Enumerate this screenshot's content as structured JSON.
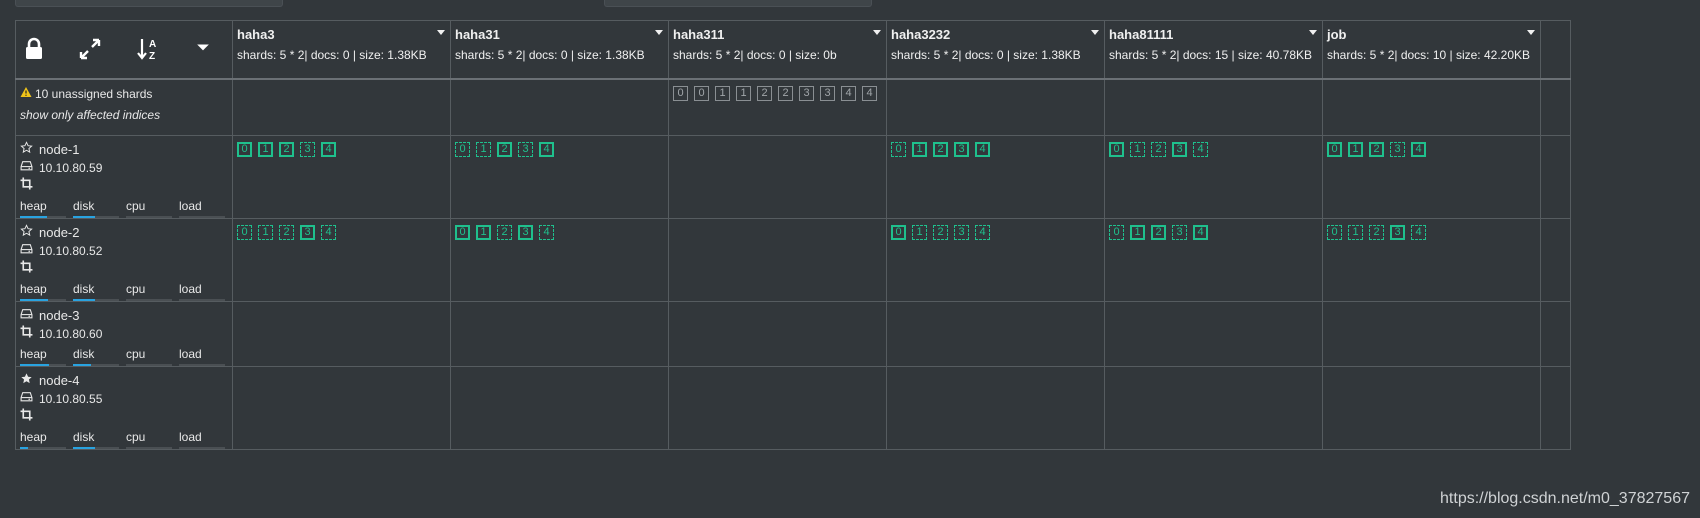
{
  "controls": [
    {
      "name": "lock-icon"
    },
    {
      "name": "expand-icon"
    },
    {
      "name": "sort-alpha-icon"
    },
    {
      "name": "caret-down-icon"
    }
  ],
  "indices": [
    {
      "name": "haha3",
      "stats": "shards: 5 * 2| docs: 0 | size: 1.38KB"
    },
    {
      "name": "haha31",
      "stats": "shards: 5 * 2| docs: 0 | size: 1.38KB"
    },
    {
      "name": "haha311",
      "stats": "shards: 5 * 2| docs: 0 | size: 0b"
    },
    {
      "name": "haha3232",
      "stats": "shards: 5 * 2| docs: 0 | size: 1.38KB"
    },
    {
      "name": "haha81111",
      "stats": "shards: 5 * 2| docs: 15 | size: 40.78KB"
    },
    {
      "name": "job",
      "stats": "shards: 5 * 2| docs: 10 | size: 42.20KB"
    }
  ],
  "unassigned": {
    "message": "10 unassigned shards",
    "filter_link": "show only affected indices",
    "shards_by_index": [
      [],
      [],
      [
        "0",
        "0",
        "1",
        "1",
        "2",
        "2",
        "3",
        "3",
        "4",
        "4"
      ],
      [],
      [],
      []
    ]
  },
  "metric_labels": [
    "heap",
    "disk",
    "cpu",
    "load"
  ],
  "nodes": [
    {
      "name": "node-1",
      "ip": "10.10.80.59",
      "master": "eligible",
      "roles": [
        "data",
        "ingest"
      ],
      "metrics": {
        "heap": 0.58,
        "disk": 0.48,
        "cpu": 0,
        "load": 0
      },
      "shards": [
        [
          {
            "n": "0",
            "t": "p"
          },
          {
            "n": "1",
            "t": "p"
          },
          {
            "n": "2",
            "t": "p"
          },
          {
            "n": "3",
            "t": "r"
          },
          {
            "n": "4",
            "t": "p"
          }
        ],
        [
          {
            "n": "0",
            "t": "r"
          },
          {
            "n": "1",
            "t": "r"
          },
          {
            "n": "2",
            "t": "p"
          },
          {
            "n": "3",
            "t": "r"
          },
          {
            "n": "4",
            "t": "p"
          }
        ],
        [],
        [
          {
            "n": "0",
            "t": "r"
          },
          {
            "n": "1",
            "t": "p"
          },
          {
            "n": "2",
            "t": "p"
          },
          {
            "n": "3",
            "t": "p"
          },
          {
            "n": "4",
            "t": "p"
          }
        ],
        [
          {
            "n": "0",
            "t": "p"
          },
          {
            "n": "1",
            "t": "r"
          },
          {
            "n": "2",
            "t": "r"
          },
          {
            "n": "3",
            "t": "p"
          },
          {
            "n": "4",
            "t": "r"
          }
        ],
        [
          {
            "n": "0",
            "t": "p"
          },
          {
            "n": "1",
            "t": "p"
          },
          {
            "n": "2",
            "t": "p"
          },
          {
            "n": "3",
            "t": "r"
          },
          {
            "n": "4",
            "t": "p"
          }
        ]
      ]
    },
    {
      "name": "node-2",
      "ip": "10.10.80.52",
      "master": "eligible",
      "roles": [
        "data",
        "ingest"
      ],
      "metrics": {
        "heap": 0.6,
        "disk": 0.48,
        "cpu": 0,
        "load": 0
      },
      "shards": [
        [
          {
            "n": "0",
            "t": "r"
          },
          {
            "n": "1",
            "t": "r"
          },
          {
            "n": "2",
            "t": "r"
          },
          {
            "n": "3",
            "t": "p"
          },
          {
            "n": "4",
            "t": "r"
          }
        ],
        [
          {
            "n": "0",
            "t": "p"
          },
          {
            "n": "1",
            "t": "p"
          },
          {
            "n": "2",
            "t": "r"
          },
          {
            "n": "3",
            "t": "p"
          },
          {
            "n": "4",
            "t": "r"
          }
        ],
        [],
        [
          {
            "n": "0",
            "t": "p"
          },
          {
            "n": "1",
            "t": "r"
          },
          {
            "n": "2",
            "t": "r"
          },
          {
            "n": "3",
            "t": "r"
          },
          {
            "n": "4",
            "t": "r"
          }
        ],
        [
          {
            "n": "0",
            "t": "r"
          },
          {
            "n": "1",
            "t": "p"
          },
          {
            "n": "2",
            "t": "p"
          },
          {
            "n": "3",
            "t": "r"
          },
          {
            "n": "4",
            "t": "p"
          }
        ],
        [
          {
            "n": "0",
            "t": "r"
          },
          {
            "n": "1",
            "t": "r"
          },
          {
            "n": "2",
            "t": "r"
          },
          {
            "n": "3",
            "t": "p"
          },
          {
            "n": "4",
            "t": "r"
          }
        ]
      ]
    },
    {
      "name": "node-3",
      "ip": "10.10.80.60",
      "master": "none",
      "roles": [
        "data",
        "ingest"
      ],
      "metrics": {
        "heap": 0.62,
        "disk": 0.4,
        "cpu": 0,
        "load": 0
      },
      "shards": [
        [],
        [],
        [],
        [],
        [],
        []
      ]
    },
    {
      "name": "node-4",
      "ip": "10.10.80.55",
      "master": "current",
      "roles": [
        "ingest"
      ],
      "metrics": {
        "heap": 0.18,
        "disk": 0.48,
        "cpu": 0,
        "load": 0
      },
      "shards": [
        [],
        [],
        [],
        [],
        [],
        []
      ]
    }
  ],
  "watermark": "https://blog.csdn.net/m0_37827567",
  "colors": {
    "background": "#32373b",
    "grid": "#565c60",
    "shard": "#1fc08d",
    "unassigned": "#8a8f93",
    "metric_bar": "#29a3e0",
    "warning": "#f0c419"
  }
}
